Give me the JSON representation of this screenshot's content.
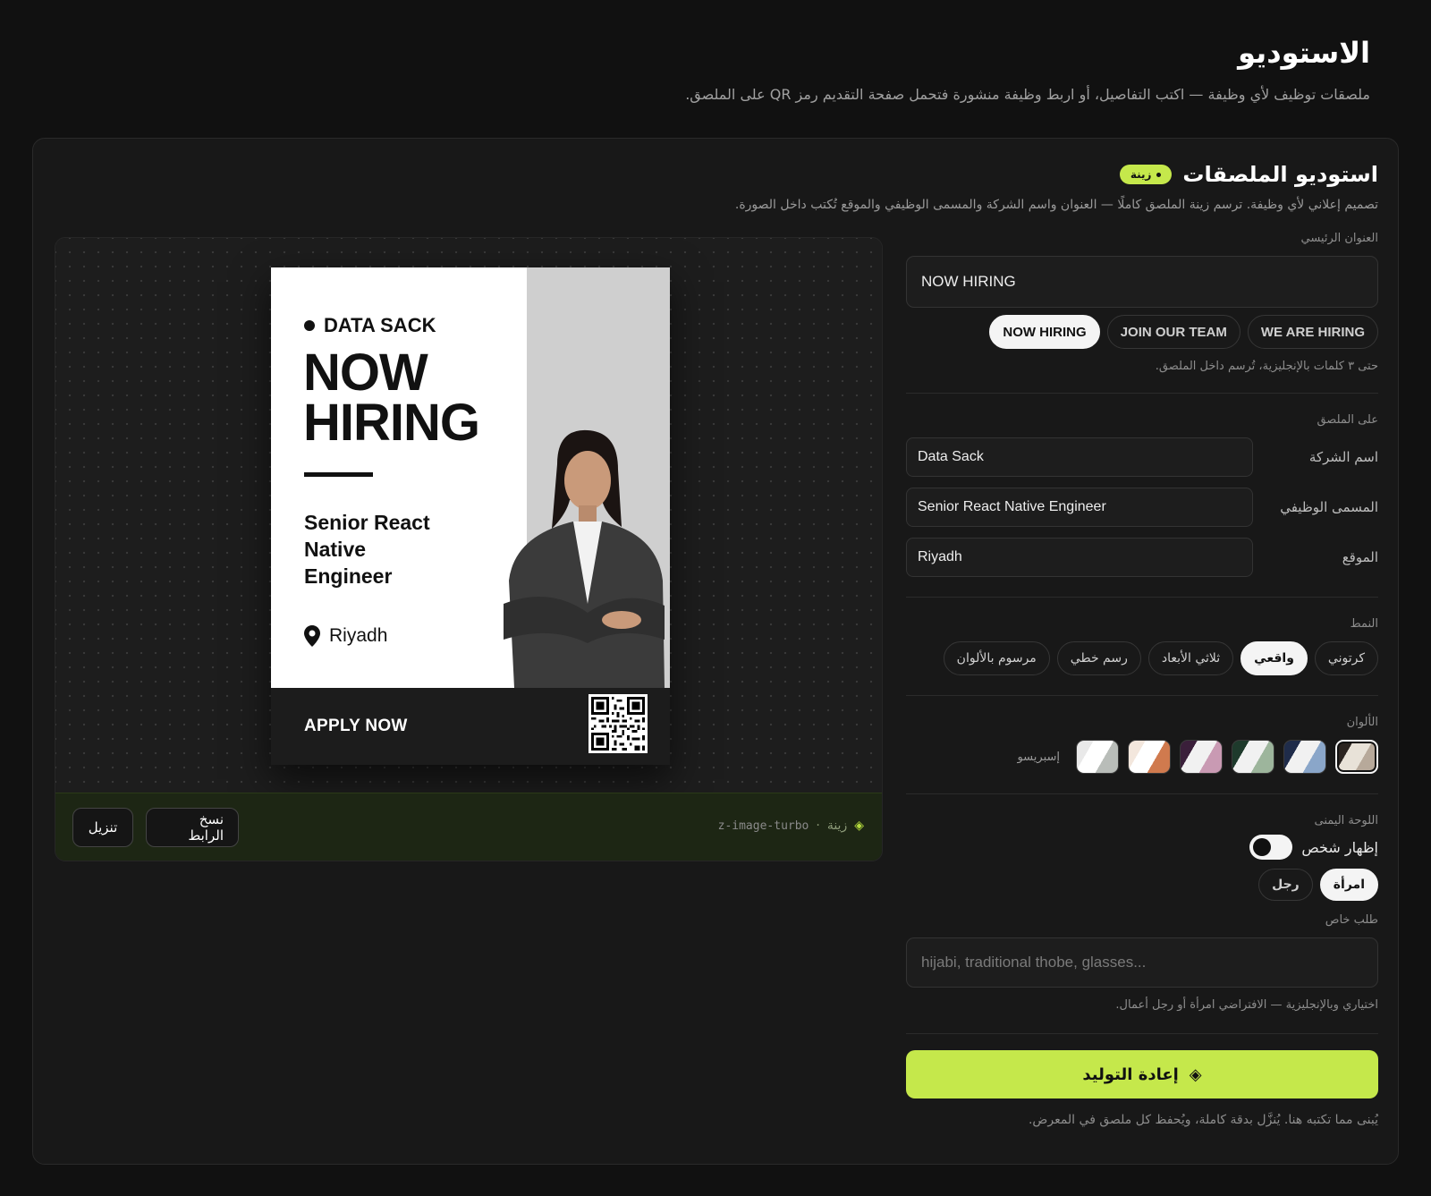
{
  "page": {
    "title": "الاستوديو",
    "subtitle": "ملصقات توظيف لأي وظيفة — اكتب التفاصيل، أو اربط وظيفة منشورة فتحمل صفحة التقديم رمز QR على الملصق."
  },
  "studio": {
    "title": "استوديو الملصقات",
    "badge": "زينة",
    "description": "تصميم إعلاني لأي وظيفة. ترسم زينة الملصق كاملًا — العنوان واسم الشركة والمسمى الوظيفي والموقع تُكتب داخل الصورة."
  },
  "poster": {
    "company": "DATA SACK",
    "headline": "NOW HIRING",
    "job_title": "Senior React Native Engineer",
    "location": "Riyadh",
    "cta": "APPLY NOW"
  },
  "preview_bar": {
    "model": "z-image-turbo",
    "engine": "زينة",
    "copy_link": "نسخ الرابط",
    "download": "تنزيل"
  },
  "form": {
    "headline_label": "العنوان الرئيسي",
    "headline_value": "NOW HIRING",
    "headline_presets": [
      "NOW HIRING",
      "JOIN OUR TEAM",
      "WE ARE HIRING"
    ],
    "headline_hint": "حتى ٣ كلمات بالإنجليزية، تُرسم داخل الملصق.",
    "on_poster_label": "على الملصق",
    "company_label": "اسم الشركة",
    "company_value": "Data Sack",
    "job_label": "المسمى الوظيفي",
    "job_value": "Senior React Native Engineer",
    "location_label": "الموقع",
    "location_value": "Riyadh",
    "style_label": "النمط",
    "styles": [
      "كرتوني",
      "واقعي",
      "ثلاثي الأبعاد",
      "رسم خطي",
      "مرسوم بالألوان"
    ],
    "active_style": "واقعي",
    "colors_label": "الألوان",
    "palette_name": "إسبريسو",
    "swatches": [
      [
        "#2b2420",
        "#e8e2d8",
        "#b7a99a"
      ],
      [
        "#1f2c4a",
        "#f1f1f1",
        "#8aa6c9"
      ],
      [
        "#1e3a2c",
        "#f1f1f1",
        "#9db59c"
      ],
      [
        "#3a1f3a",
        "#f1f1f1",
        "#c99ab3"
      ],
      [
        "#f3e7dd",
        "#ffffff",
        "#d07a4e"
      ],
      [
        "#e9e9e9",
        "#ffffff",
        "#b9bdb9"
      ]
    ],
    "right_panel_label": "اللوحة اليمنى",
    "show_person": "إظهار شخص",
    "show_person_on": true,
    "genders": [
      "امرأة",
      "رجل"
    ],
    "active_gender": "امرأة",
    "special_label": "طلب خاص",
    "special_placeholder": "hijabi, traditional thobe, glasses...",
    "special_hint": "اختياري وبالإنجليزية — الافتراضي امرأة أو رجل أعمال.",
    "regenerate": "إعادة التوليد",
    "footnote": "يُبنى مما تكتبه هنا. يُنزَّل بدقة كاملة، ويُحفظ كل ملصق في المعرض."
  }
}
